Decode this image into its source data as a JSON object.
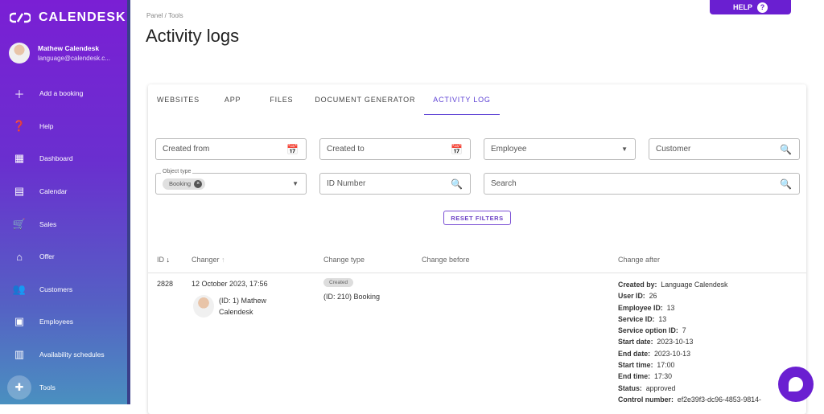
{
  "app": {
    "name": "CALENDESK"
  },
  "user": {
    "name": "Mathew Calendesk",
    "email": "language@calendesk.c..."
  },
  "nav": [
    {
      "label": "Add a booking",
      "icon": "plus-icon"
    },
    {
      "label": "Help",
      "icon": "help-icon"
    },
    {
      "label": "Dashboard",
      "icon": "dashboard-icon"
    },
    {
      "label": "Calendar",
      "icon": "calendar-icon"
    },
    {
      "label": "Sales",
      "icon": "cart-icon"
    },
    {
      "label": "Offer",
      "icon": "store-icon"
    },
    {
      "label": "Customers",
      "icon": "people-icon"
    },
    {
      "label": "Employees",
      "icon": "badge-icon"
    },
    {
      "label": "Availability schedules",
      "icon": "schedule-icon"
    },
    {
      "label": "Tools",
      "icon": "puzzle-icon"
    }
  ],
  "breadcrumb": "Panel / Tools",
  "title": "Activity logs",
  "help": "HELP",
  "tabs": [
    "WEBSITES",
    "APP",
    "FILES",
    "DOCUMENT GENERATOR",
    "ACTIVITY LOG"
  ],
  "filters": {
    "created_from": "Created from",
    "created_to": "Created to",
    "employee": "Employee",
    "customer": "Customer",
    "object_type_label": "Object type",
    "object_type_chip": "Booking",
    "id_number": "ID Number",
    "search": "Search",
    "reset": "RESET FILTERS"
  },
  "table": {
    "headers": {
      "id": "ID",
      "changer": "Changer",
      "change_type": "Change type",
      "before": "Change before",
      "after": "Change after"
    },
    "rows": [
      {
        "id": "2828",
        "date": "12 October 2023, 17:56",
        "changer_line1": "(ID: 1) Mathew",
        "changer_line2": "Calendesk",
        "badge": "Created",
        "type": "(ID: 210) Booking",
        "after": [
          {
            "k": "Created by:",
            "v": "Language Calendesk"
          },
          {
            "k": "User ID:",
            "v": "26"
          },
          {
            "k": "Employee ID:",
            "v": "13"
          },
          {
            "k": "Service ID:",
            "v": "13"
          },
          {
            "k": "Service option ID:",
            "v": "7"
          },
          {
            "k": "Start date:",
            "v": "2023-10-13"
          },
          {
            "k": "End date:",
            "v": "2023-10-13"
          },
          {
            "k": "Start time:",
            "v": "17:00"
          },
          {
            "k": "End time:",
            "v": "17:30"
          },
          {
            "k": "Status:",
            "v": "approved"
          },
          {
            "k": "Control number:",
            "v": "ef2e39f3-dc96-4853-9814-"
          }
        ]
      }
    ]
  }
}
